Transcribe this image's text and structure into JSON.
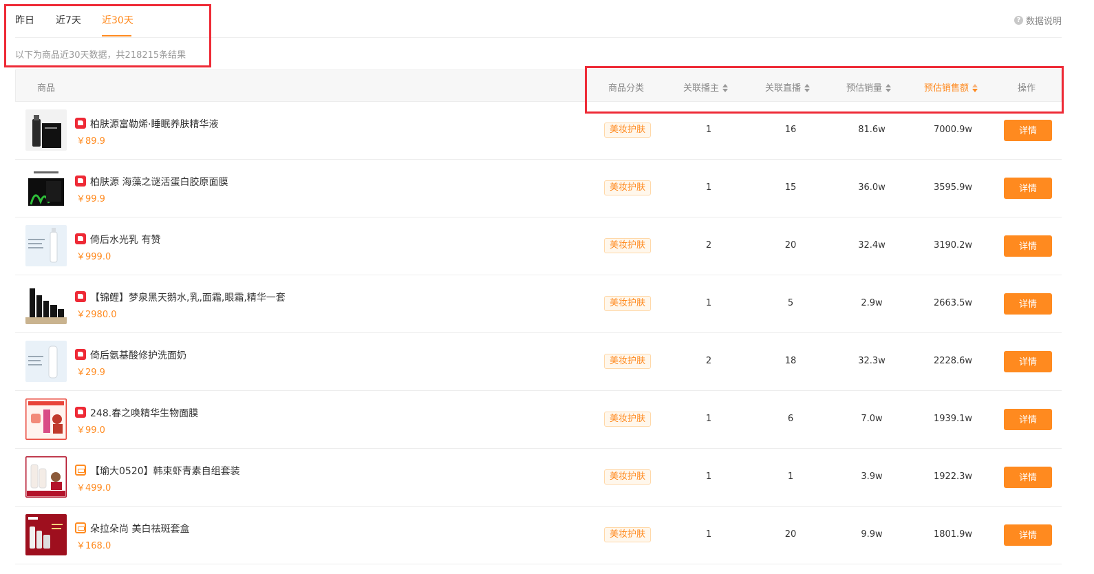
{
  "tabs": [
    {
      "label": "昨日",
      "active": false
    },
    {
      "label": "近7天",
      "active": false
    },
    {
      "label": "近30天",
      "active": true
    }
  ],
  "help_label": "数据说明",
  "help_icon": "question-circle-icon",
  "summary": "以下为商品近30天数据，共218215条结果",
  "columns": {
    "product": "商品",
    "category": "商品分类",
    "related_hosts": "关联播主",
    "related_lives": "关联直播",
    "est_sales": "预估销量",
    "est_revenue": "预估销售额",
    "action": "操作"
  },
  "sorted_column": "预估销售额",
  "accent_color": "#ff8a1f",
  "highlight_color": "#ee2a36",
  "rows": [
    {
      "name": "柏肤源富勒烯·睡眠养肤精华液",
      "price": "￥89.9",
      "badge": "thumb-up-icon",
      "category": "美妆护肤",
      "hosts": "1",
      "lives": "16",
      "sales": "81.6w",
      "revenue": "7000.9w",
      "action": "详情"
    },
    {
      "name": "柏肤源 海藻之谜活蛋白胶原面膜",
      "price": "￥99.9",
      "badge": "thumb-up-icon",
      "category": "美妆护肤",
      "hosts": "1",
      "lives": "15",
      "sales": "36.0w",
      "revenue": "3595.9w",
      "action": "详情"
    },
    {
      "name": "倚后水光乳 有赞",
      "price": "￥999.0",
      "badge": "thumb-up-icon",
      "category": "美妆护肤",
      "hosts": "2",
      "lives": "20",
      "sales": "32.4w",
      "revenue": "3190.2w",
      "action": "详情"
    },
    {
      "name": "【锦鲤】梦泉黑天鹅水,乳,面霜,眼霜,精华一套",
      "price": "￥2980.0",
      "badge": "thumb-up-icon",
      "category": "美妆护肤",
      "hosts": "1",
      "lives": "5",
      "sales": "2.9w",
      "revenue": "2663.5w",
      "action": "详情"
    },
    {
      "name": "倚后氨基酸修护洗面奶",
      "price": "￥29.9",
      "badge": "thumb-up-icon",
      "category": "美妆护肤",
      "hosts": "2",
      "lives": "18",
      "sales": "32.3w",
      "revenue": "2228.6w",
      "action": "详情"
    },
    {
      "name": "248.春之唤精华生物面膜",
      "price": "￥99.0",
      "badge": "thumb-up-icon",
      "category": "美妆护肤",
      "hosts": "1",
      "lives": "6",
      "sales": "7.0w",
      "revenue": "1939.1w",
      "action": "详情"
    },
    {
      "name": "【瑜大0520】韩束虾青素自组套装",
      "price": "￥499.0",
      "badge": "shop-icon",
      "category": "美妆护肤",
      "hosts": "1",
      "lives": "1",
      "sales": "3.9w",
      "revenue": "1922.3w",
      "action": "详情"
    },
    {
      "name": "朵拉朵尚 美白祛斑套盒",
      "price": "￥168.0",
      "badge": "shop-icon",
      "category": "美妆护肤",
      "hosts": "1",
      "lives": "20",
      "sales": "9.9w",
      "revenue": "1801.9w",
      "action": "详情"
    }
  ]
}
